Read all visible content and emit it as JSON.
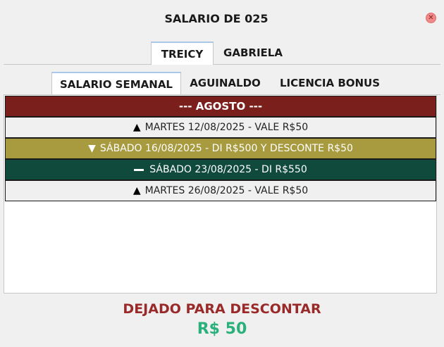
{
  "window": {
    "title": "SALARIO DE 025"
  },
  "person_tabs": [
    {
      "label": "TREICY",
      "active": true
    },
    {
      "label": "GABRIELA",
      "active": false
    }
  ],
  "section_tabs": [
    {
      "label": "SALARIO SEMANAL",
      "active": true
    },
    {
      "label": "AGUINALDO",
      "active": false
    },
    {
      "label": "LICENCIA BONUS",
      "active": false
    }
  ],
  "month_header": "--- AGOSTO ---",
  "entries": [
    {
      "icon": "triangle-up-icon",
      "text": "MARTES 12/08/2025 - VALE R$50"
    },
    {
      "icon": "triangle-down-icon",
      "text": "SÁBADO 16/08/2025 - DI R$500 Y DESCONTE R$50"
    },
    {
      "icon": "dash-icon",
      "text": "SÁBADO 23/08/2025 - DI R$550"
    },
    {
      "icon": "triangle-up-icon",
      "text": "MARTES 26/08/2025 - VALE R$50"
    }
  ],
  "summary": {
    "label": "DEJADO PARA DESCONTAR",
    "value": "R$ 50"
  },
  "colors": {
    "header_bg": "#7a1f1c",
    "gold_bg": "#a89a3e",
    "teal_bg": "#0f4a3c",
    "light_bg": "#f0f0f0",
    "summary_label": "#9a2a2a",
    "summary_value": "#2ab07a"
  }
}
